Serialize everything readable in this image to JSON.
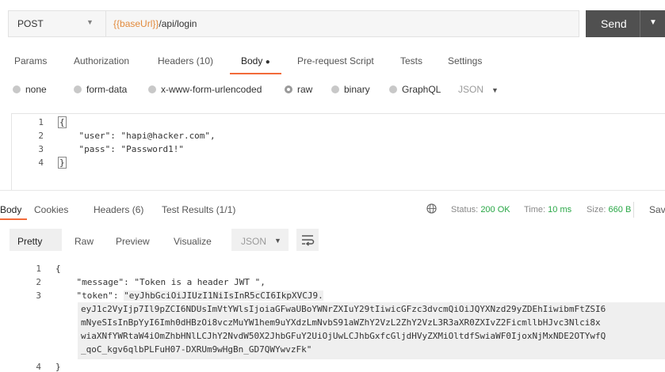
{
  "request": {
    "method": "POST",
    "url_var": "{{baseUrl}}",
    "url_path": "/api/login",
    "send_label": "Send"
  },
  "tabs": {
    "params": "Params",
    "authorization": "Authorization",
    "headers": "Headers (10)",
    "body": "Body",
    "body_dot": "●",
    "prerequest": "Pre-request Script",
    "tests": "Tests",
    "settings": "Settings"
  },
  "body_types": {
    "none": "none",
    "form_data": "form-data",
    "urlencoded": "x-www-form-urlencoded",
    "raw": "raw",
    "binary": "binary",
    "graphql": "GraphQL",
    "format": "JSON"
  },
  "request_body": {
    "lines": [
      "1",
      "2",
      "3",
      "4"
    ],
    "open": "{",
    "line2": "    \"user\": \"hapi@hacker.com\",",
    "line3": "    \"pass\": \"Password1!\"",
    "close": "}"
  },
  "response_tabs": {
    "body": "Body",
    "cookies": "Cookies",
    "headers": "Headers (6)",
    "test_results": "Test Results (1/1)"
  },
  "response_meta": {
    "status_label": "Status:",
    "status_value": "200 OK",
    "time_label": "Time:",
    "time_value": "10 ms",
    "size_label": "Size:",
    "size_value": "660 B",
    "save": "Sav"
  },
  "response_view": {
    "pretty": "Pretty",
    "raw": "Raw",
    "preview": "Preview",
    "visualize": "Visualize",
    "format": "JSON"
  },
  "response_body": {
    "ln1": "1",
    "ln2": "2",
    "ln3": "3",
    "ln4": "4",
    "line1": "{",
    "line2": "    \"message\": \"Token is a header JWT \",",
    "line3": "    \"token\": \"eyJhbGciOiJIUzI1NiIsInR5cCI6IkpXVCJ9.",
    "wrap1": "eyJ1c2VyIjp7Il9pZCI6NDUsImVtYWlsIjoiaGFwaUBoYWNrZXIuY29tIiwicGFzc3dvcmQiOiJQYXNzd29yZDEhIiwibmFtZSI6",
    "wrap2": "mNyeSIsInBpYyI6Imh0dHBzOi8vczMuYW1hem9uYXdzLmNvbS91aWZhY2VzL2ZhY2VzL3R3aXR0ZXIvZ2FicmllbHJvc3Nlci8x",
    "wrap3": "wiaXNfYWRtaW4iOmZhbHNlLCJhY2NvdW50X2JhbGFuY2UiOjUwLCJhbGxfcGljdHVyZXMiOltdfSwiaWF0IjoxNjMxNDE2OTYwfQ",
    "wrap4": "_qoC_kgv6qlbPLFuH07-DXRUm9wHgBn_GD7QWYwvzFk\"",
    "line4": "}"
  }
}
